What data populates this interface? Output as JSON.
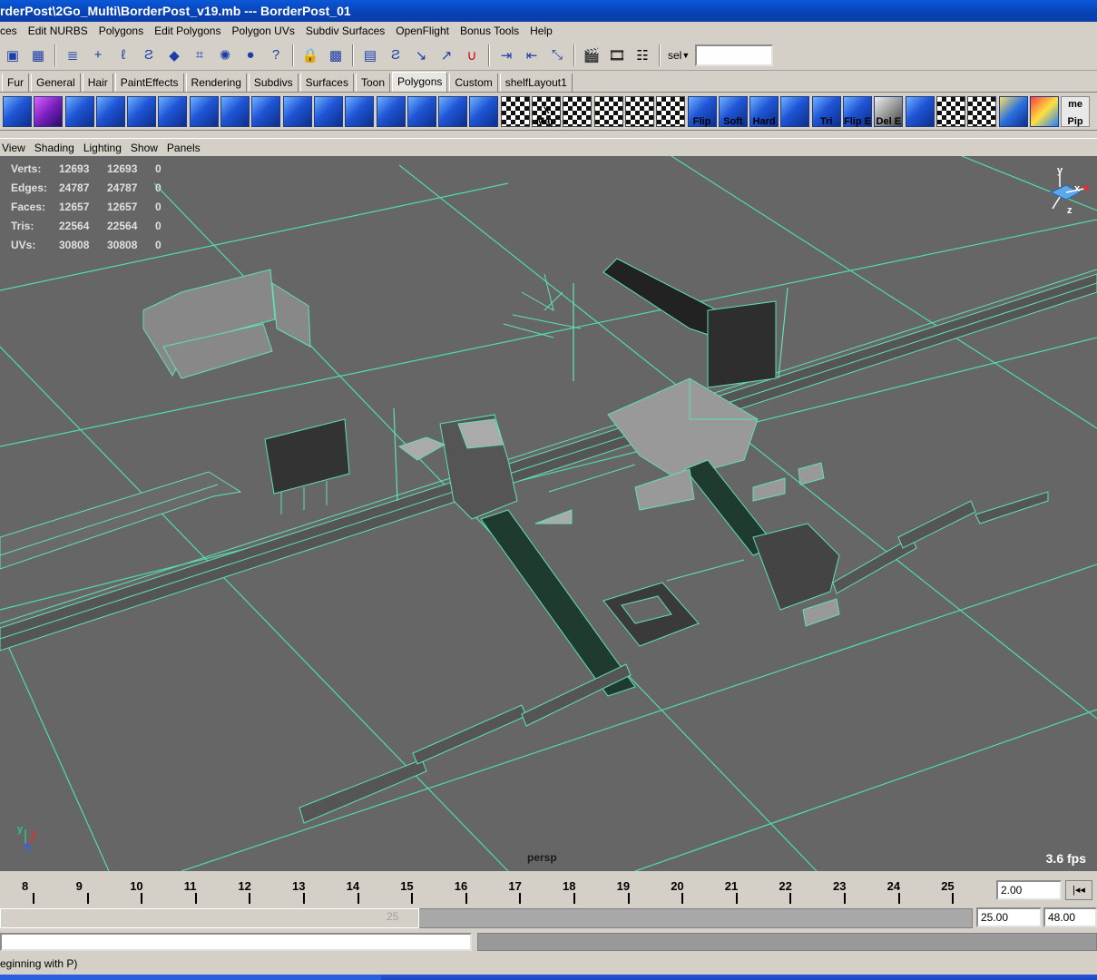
{
  "window": {
    "title": "rderPost\\2Go_Multi\\BorderPost_v19.mb   ---   BorderPost_01"
  },
  "menu": [
    "ces",
    "Edit NURBS",
    "Polygons",
    "Edit Polygons",
    "Polygon UVs",
    "Subdiv Surfaces",
    "OpenFlight",
    "Bonus Tools",
    "Help"
  ],
  "status_line": {
    "sel_label": "sel",
    "sel_value": ""
  },
  "shelf_tabs": [
    "Fur",
    "General",
    "Hair",
    "PaintEffects",
    "Rendering",
    "Subdivs",
    "Surfaces",
    "Toon",
    "Polygons",
    "Custom",
    "shelfLayout1"
  ],
  "shelf_active_tab": "Polygons",
  "shelf_icon_labels": {
    "xmap": "X Map",
    "flip": "Flip",
    "soft": "Soft",
    "hard": "Hard",
    "tri": "Tri",
    "flipe": "Flip E",
    "dele": "Del E",
    "pip": "Pip",
    "me": "me"
  },
  "panel_menu": [
    "View",
    "Shading",
    "Lighting",
    "Show",
    "Panels"
  ],
  "hud": {
    "rows": [
      {
        "label": "Verts:",
        "a": "12693",
        "b": "12693",
        "c": "0"
      },
      {
        "label": "Edges:",
        "a": "24787",
        "b": "24787",
        "c": "0"
      },
      {
        "label": "Faces:",
        "a": "12657",
        "b": "12657",
        "c": "0"
      },
      {
        "label": "Tris:",
        "a": "22564",
        "b": "22564",
        "c": "0"
      },
      {
        "label": "UVs:",
        "a": "30808",
        "b": "30808",
        "c": "0"
      }
    ]
  },
  "viewport": {
    "camera": "persp",
    "fps": "3.6 fps",
    "axis_x": "x",
    "axis_y": "y",
    "axis_z": "z"
  },
  "timeline": {
    "ticks": [
      "8",
      "9",
      "10",
      "11",
      "12",
      "13",
      "14",
      "15",
      "16",
      "17",
      "18",
      "19",
      "20",
      "21",
      "22",
      "23",
      "24",
      "25"
    ],
    "current_time": "2.00",
    "play_back_label": "|◂◂"
  },
  "range": {
    "handle_value": "25",
    "end_time": "25.00",
    "anim_end": "48.00"
  },
  "help_line": {
    "text": "eginning with P)"
  },
  "colors": {
    "wire": "#5fe3b0",
    "viewport_bg": "#666666",
    "title_blue": "#0842b4"
  }
}
